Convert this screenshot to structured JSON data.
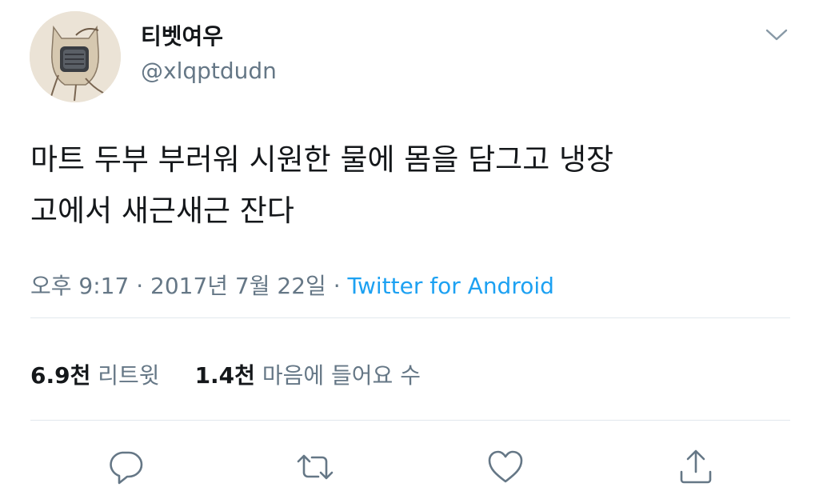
{
  "user": {
    "display_name": "티벳여우",
    "handle": "@xlqptdudn"
  },
  "tweet": {
    "text_line1": "마트 두부 부러워 시원한 물에 몸을 담그고 냉장",
    "text_line2": "고에서 새근새근 잔다",
    "time": "오후 9:17",
    "separator1": " · ",
    "date": "2017년 7월 22일",
    "separator2": " · ",
    "source": "Twitter for Android"
  },
  "stats": {
    "retweets_count": "6.9천",
    "retweets_label": "리트윗",
    "likes_count": "1.4천",
    "likes_label": "마음에 들어요 수"
  },
  "icons": {
    "menu": "chevron-down-icon",
    "reply": "comment-icon",
    "retweet": "retweet-icon",
    "like": "heart-icon",
    "share": "share-icon"
  },
  "colors": {
    "text": "#14171a",
    "secondary_text": "#657786",
    "link": "#1da1f2",
    "divider": "#e1e8ed"
  }
}
